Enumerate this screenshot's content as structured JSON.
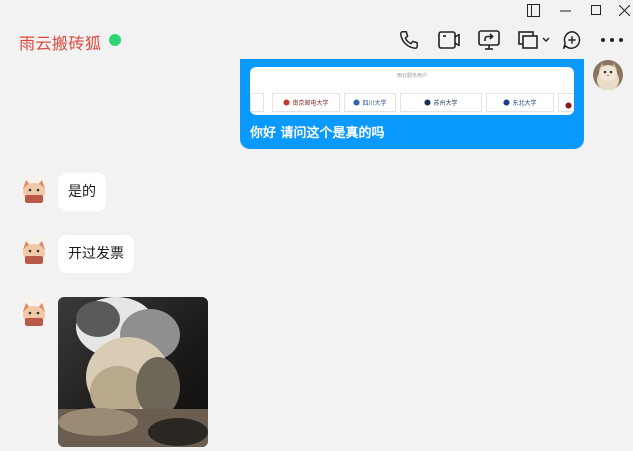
{
  "header": {
    "contact_name": "雨云搬砖狐",
    "status": "online"
  },
  "colors": {
    "name": "#e0463b",
    "online": "#2ed573",
    "sent_bubble": "#0a99ff",
    "background": "#f2f2f2"
  },
  "toolbar": {
    "icons": [
      "phone-icon",
      "video-camera-icon",
      "screen-share-icon",
      "remote-desktop-icon",
      "add-circle-icon",
      "more-icon"
    ]
  },
  "window": {
    "icons": [
      "sidebar-toggle-icon",
      "minimize-icon",
      "maximize-icon",
      "close-icon"
    ]
  },
  "messages": {
    "sent_1": {
      "preview_title": "雨云服务用户",
      "text": "你好 请问这个是真的吗",
      "logos": [
        "南京邮电大学",
        "四川大学",
        "苏州大学",
        "东北大学"
      ]
    },
    "recv_1": {
      "text": "是的"
    },
    "recv_2": {
      "text": "开过发票"
    },
    "recv_3": {
      "image": "cat-photo"
    }
  }
}
